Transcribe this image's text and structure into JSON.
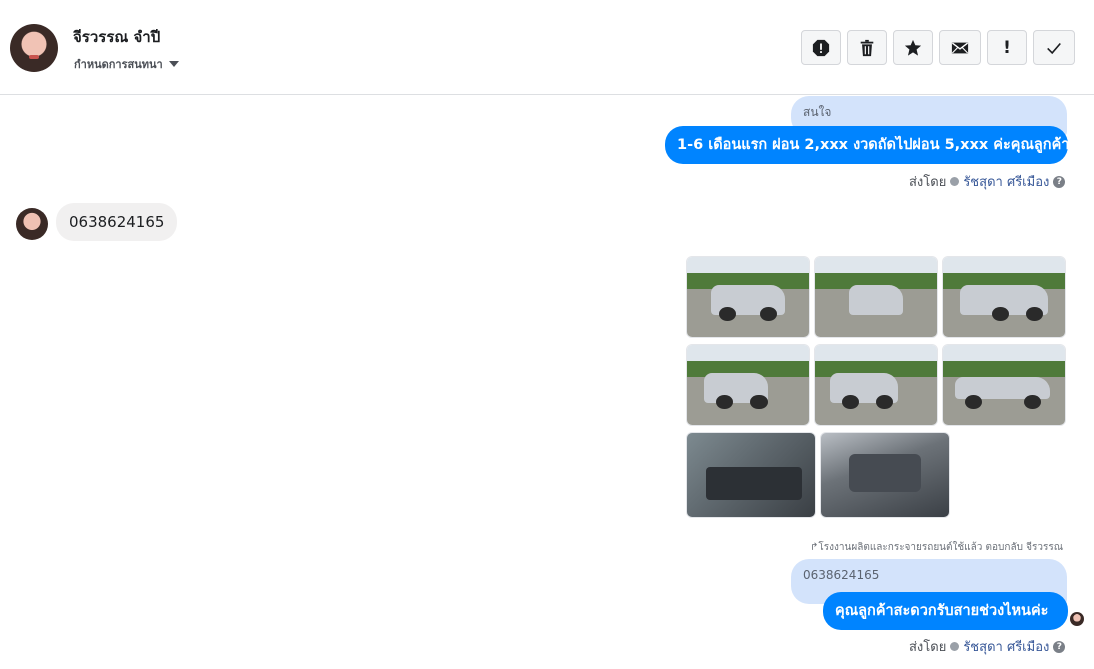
{
  "header": {
    "contact_name": "จีรวรรณ จำปี",
    "conversation_settings_label": "กำหนดการสนทนา",
    "toolbar": [
      {
        "name": "report-icon",
        "label": ""
      },
      {
        "name": "trash-icon",
        "label": ""
      },
      {
        "name": "star-icon",
        "label": ""
      },
      {
        "name": "envelope-icon",
        "label": ""
      },
      {
        "name": "exclamation-icon",
        "label": "!"
      },
      {
        "name": "check-icon",
        "label": ""
      }
    ]
  },
  "messages": {
    "msg1": {
      "quoted_text": "สนใจ",
      "text": "1-6 เดือนแรก ผ่อน 2,xxx งวดถัดไปผ่อน 5,xxx ค่ะคุณลูกค้า",
      "sent_by_label": "ส่งโดย",
      "agent": "รัชสุดา ศรีเมือง"
    },
    "msg2": {
      "text": "0638624165"
    },
    "photos": {
      "count": 8,
      "icons": [
        "car-photo",
        "car-photo",
        "car-photo",
        "car-photo",
        "car-photo",
        "car-photo",
        "car-interior-photo",
        "car-engine-photo"
      ]
    },
    "reply_note": "↱โรงงานผลิตและกระจายรถยนต์ใช้แล้ว ตอบกลับ จีรวรรณ",
    "msg3": {
      "quoted_text": "0638624165",
      "text": "คุณลูกค้าสะดวกรับสายช่วงไหนค่ะ",
      "sent_by_label": "ส่งโดย",
      "agent": "รัชสุดา ศรีเมือง"
    }
  },
  "colors": {
    "outgoing_bubble": "#0084ff",
    "quoted_bubble": "#d3e3fb",
    "incoming_bubble": "#f1f0f0",
    "agent_link": "#385898"
  }
}
